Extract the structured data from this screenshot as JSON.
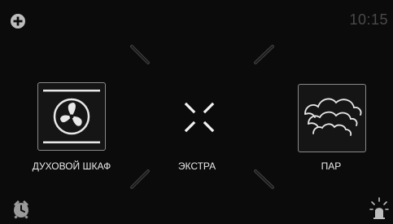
{
  "status": {
    "time": "10:15"
  },
  "modes": [
    {
      "label": "ДУХОВОЙ ШКАФ",
      "icon": "fan-icon"
    },
    {
      "label": "ЭКСТРА",
      "icon": "extra-icon"
    },
    {
      "label": "ПАР",
      "icon": "steam-icon"
    }
  ],
  "colors": {
    "background": "#0b0b0b",
    "text": "#e9e9e9",
    "muted": "#4a4a4a",
    "tile_border": "#8a8a8a"
  },
  "icons": {
    "top_left": "plus-icon",
    "bottom_left": "alarm-clock-icon",
    "bottom_right": "lamp-icon"
  }
}
